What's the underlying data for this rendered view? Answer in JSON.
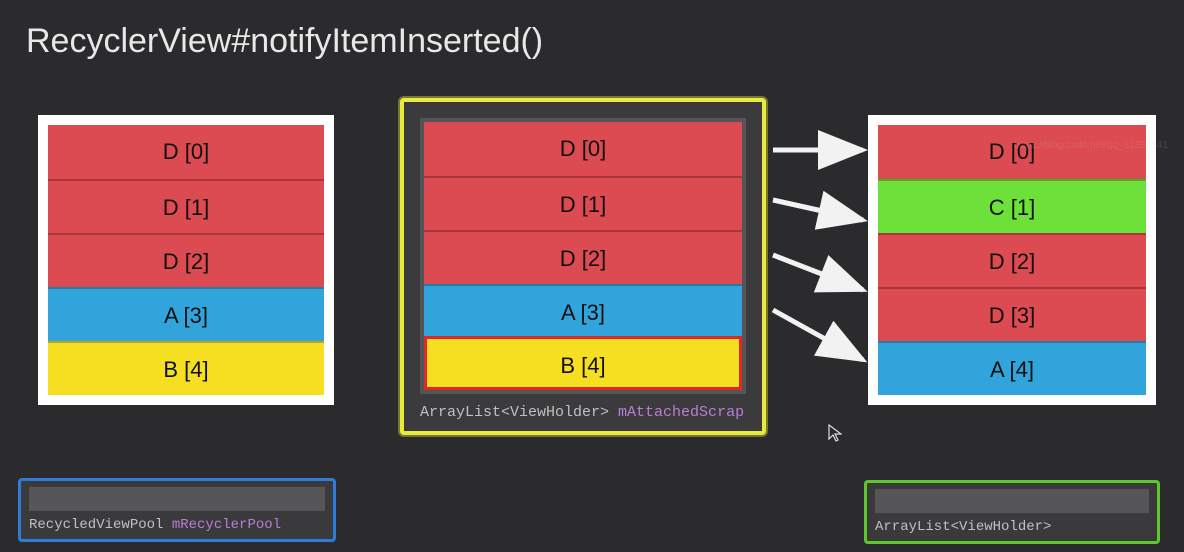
{
  "title": "RecyclerView#notifyItemInserted()",
  "left_items": [
    {
      "label": "D [0]",
      "color": "red"
    },
    {
      "label": "D [1]",
      "color": "red"
    },
    {
      "label": "D [2]",
      "color": "red"
    },
    {
      "label": "A [3]",
      "color": "blue"
    },
    {
      "label": "B [4]",
      "color": "yellow"
    }
  ],
  "scrap_items": [
    {
      "label": "D [0]",
      "color": "red"
    },
    {
      "label": "D [1]",
      "color": "red"
    },
    {
      "label": "D [2]",
      "color": "red"
    },
    {
      "label": "A [3]",
      "color": "blue"
    },
    {
      "label": "B [4]",
      "color": "yellow",
      "highlight": true
    }
  ],
  "scrap_caption_type": "ArrayList<ViewHolder>",
  "scrap_caption_field": "mAttachedScrap",
  "right_items": [
    {
      "label": "D [0]",
      "color": "red"
    },
    {
      "label": "C [1]",
      "color": "green"
    },
    {
      "label": "D [2]",
      "color": "red"
    },
    {
      "label": "D [3]",
      "color": "red"
    },
    {
      "label": "A [4]",
      "color": "blue"
    }
  ],
  "pool_caption_type": "RecycledViewPool",
  "pool_caption_field": "mRecyclerPool",
  "changed_caption_type": "ArrayList<ViewHolder>",
  "watermark": "https://blog.csdn.net/qq_31339141",
  "colors": {
    "red": "#dc4a52",
    "blue": "#31a4dc",
    "yellow": "#f5df20",
    "green": "#6de03a",
    "scrap_border": "#e8eb3b",
    "pool_border": "#2f7cd8",
    "changed_border": "#5ec72c"
  }
}
